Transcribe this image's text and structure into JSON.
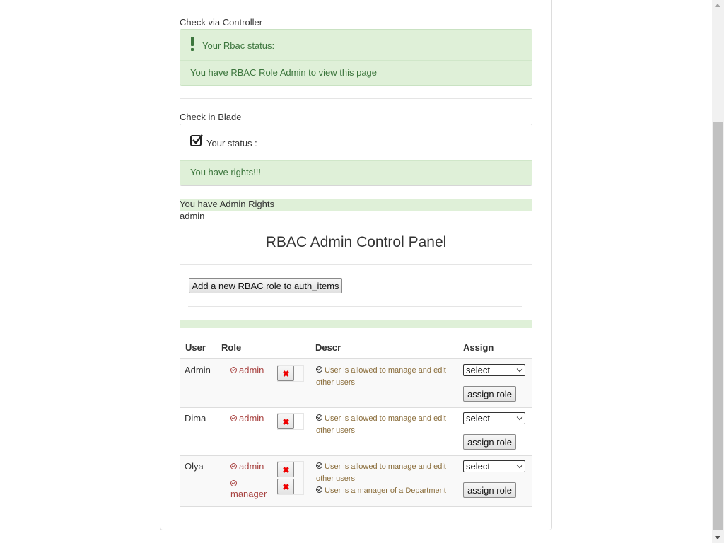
{
  "controller_check": {
    "section_label": "Check via Controller",
    "alert_title": "Your Rbac status:",
    "alert_message": "You have RBAC Role Admin to view this page"
  },
  "blade_check": {
    "section_label": "Check in Blade",
    "status_title": "Your status :",
    "status_message": "You have rights!!!"
  },
  "admin_rights_line": "You have Admin Rights",
  "current_user": "admin",
  "panel": {
    "title": "RBAC Admin Control Panel",
    "add_role_button": "Add a new RBAC role to auth_items"
  },
  "table": {
    "headers": {
      "user": "User",
      "role": "Role",
      "descr": "Descr",
      "assign": "Assign"
    },
    "assign_button": "assign role",
    "select_value": "select",
    "rows": [
      {
        "user": "Admin",
        "roles": [
          "admin"
        ],
        "descriptions": [
          "User is allowed to manage and edit other users"
        ]
      },
      {
        "user": "Dima",
        "roles": [
          "admin"
        ],
        "descriptions": [
          "User is allowed to manage and edit other users"
        ]
      },
      {
        "user": "Olya",
        "roles": [
          "admin",
          "manager"
        ],
        "descriptions": [
          "User is allowed to manage and edit other users",
          "User is a manager of a Department"
        ]
      }
    ]
  },
  "colors": {
    "success_bg": "#dff0d8",
    "success_text": "#3c763d",
    "role_text": "#a94442",
    "descr_text": "#8a6d3b",
    "delete_icon": "#ee0000"
  }
}
